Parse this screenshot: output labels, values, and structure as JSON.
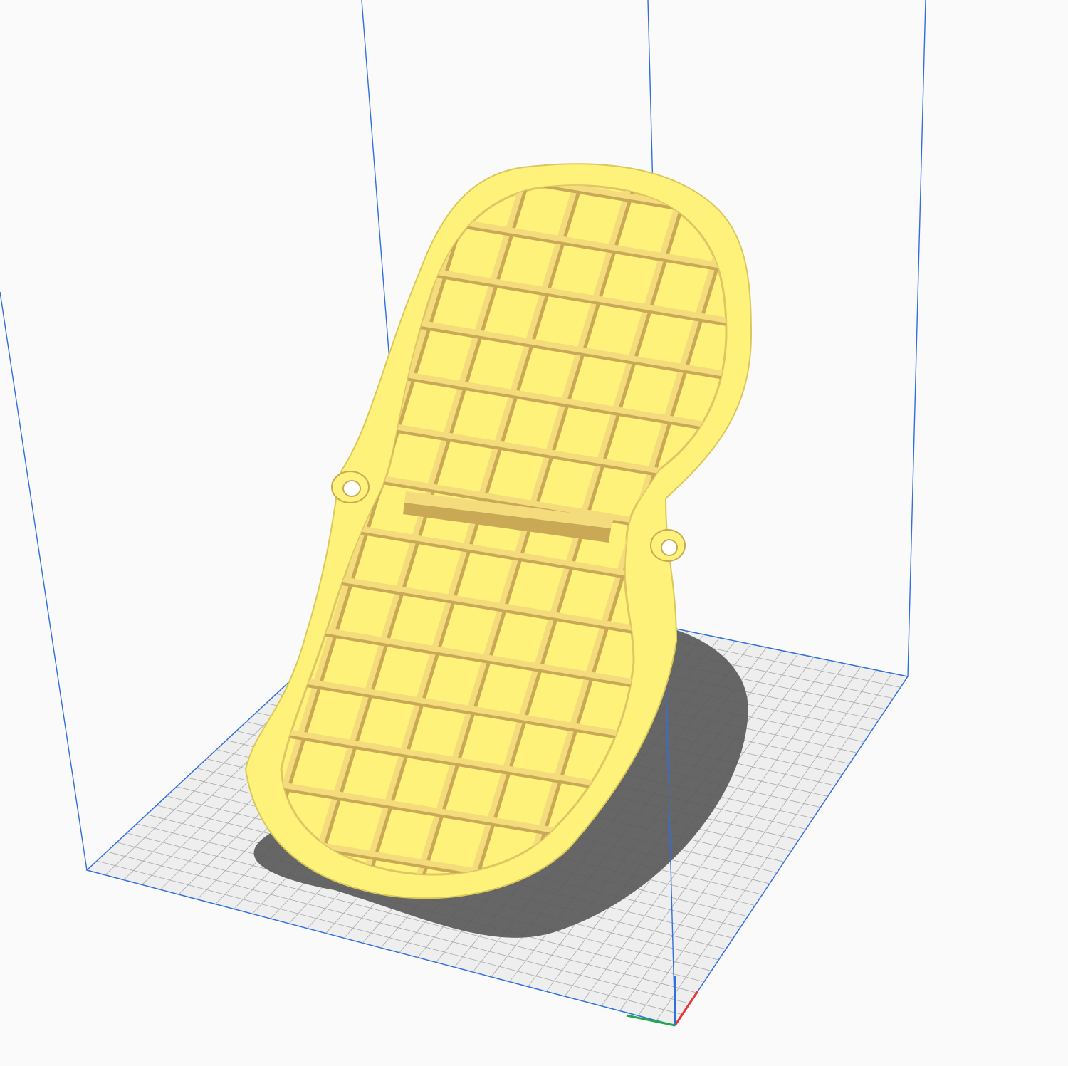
{
  "app": {
    "view": "3d-viewport",
    "theme": {
      "background": "#fafafa",
      "build_volume_edge": "#2f6fe0",
      "build_plate": "#eeeeee",
      "build_plate_grid": "#a9a9a9",
      "model_color": "#fff27a",
      "model_shadow": "#d9c85a",
      "model_rib": "#f4dc7c",
      "model_rib_shadow": "#c9a955",
      "shadow_color": "#5a5a5a",
      "axis_x": "#e53935",
      "axis_y": "#22a84b",
      "axis_z": "#2f6fe0"
    }
  },
  "viewport": {
    "model": {
      "shape": "oval-mesh-grille",
      "grid_rows": 13,
      "grid_cols": 7
    },
    "axis_gizmo": {
      "x_label": "x-axis",
      "y_label": "y-axis",
      "z_label": "z-axis"
    }
  }
}
